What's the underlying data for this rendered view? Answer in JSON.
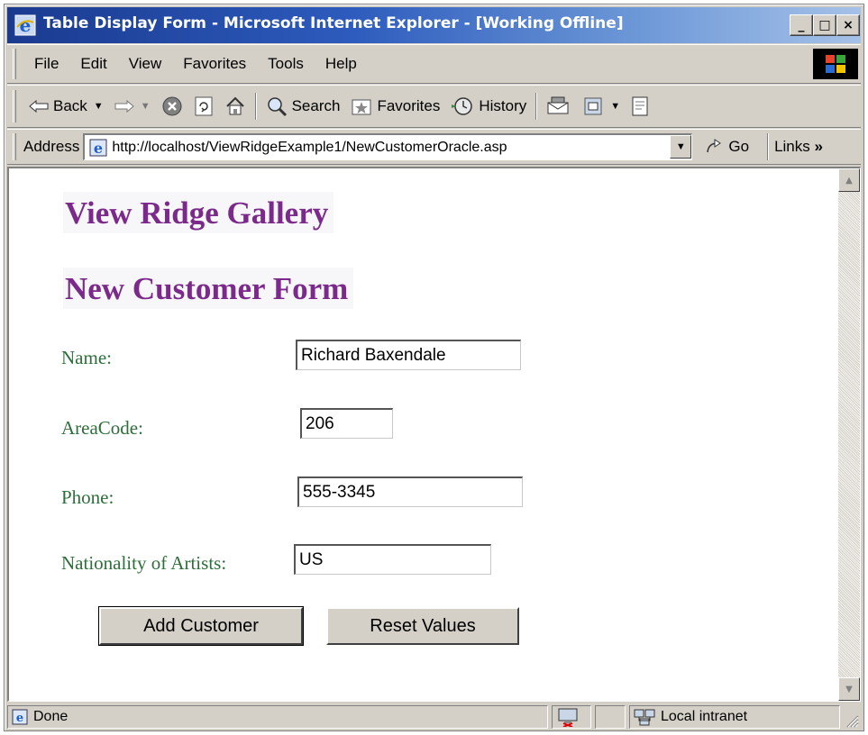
{
  "window": {
    "title": "Table Display Form - Microsoft Internet Explorer - [Working Offline]",
    "controls": {
      "minimize": "_",
      "maximize": "□",
      "close": "×"
    }
  },
  "menu": {
    "items": [
      "File",
      "Edit",
      "View",
      "Favorites",
      "Tools",
      "Help"
    ]
  },
  "toolbar": {
    "back_label": "Back",
    "search_label": "Search",
    "favorites_label": "Favorites",
    "history_label": "History"
  },
  "address": {
    "label": "Address",
    "url": "http://localhost/ViewRidgeExample1/NewCustomerOracle.asp",
    "go_label": "Go",
    "links_label": "Links",
    "links_chevron": "»"
  },
  "page": {
    "heading1": "View Ridge Gallery",
    "heading2": "New Customer Form",
    "form": {
      "name_label": "Name:",
      "name_value": "Richard Baxendale",
      "areacode_label": "AreaCode:",
      "areacode_value": "206",
      "phone_label": "Phone:",
      "phone_value": "555-3345",
      "nationality_label": "Nationality of Artists:",
      "nationality_value": "US",
      "add_button": "Add Customer",
      "reset_button": "Reset Values"
    }
  },
  "status": {
    "text": "Done",
    "zone": "Local intranet"
  },
  "colors": {
    "heading": "#7b2a8c",
    "label": "#2e6e3a",
    "title_bar_start": "#1a3a8f",
    "title_bar_end": "#a6c1e8"
  }
}
